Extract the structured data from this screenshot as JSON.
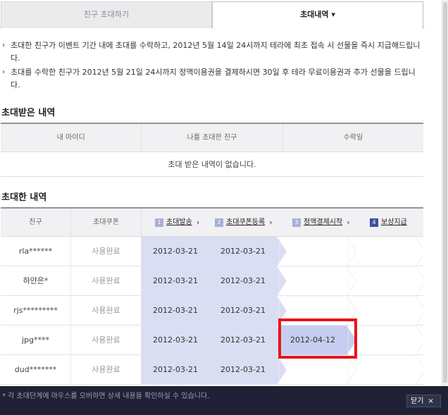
{
  "tabs": {
    "invite": "친구 초대하기",
    "history": "초대내역",
    "history_caret": "▼"
  },
  "notes": [
    {
      "bullet": "›",
      "text": "초대한 친구가 이벤트 기간 내에 초대를 수락하고, 2012년 5월 14일 24시까지 테라에 최초 접속 시 선물을 즉시 지급해드립니다."
    },
    {
      "bullet": "›",
      "text": "초대를 수락한 친구가 2012년 5월 21일 24시까지 정액이용권을 결제하시면 30일 후 테라 무료이용권과 추가 선물을 드립니다."
    }
  ],
  "received": {
    "title": "초대받은 내역",
    "headers": [
      "내 아이디",
      "나를 초대한 친구",
      "수락일"
    ],
    "empty": "초대 받은 내역이 없습니다."
  },
  "sent": {
    "title": "초대한 내역",
    "col_friend": "친구",
    "col_coupon": "초대쿠폰",
    "steps": [
      {
        "num": "1",
        "label": "초대발송",
        "arrow": "›"
      },
      {
        "num": "2",
        "label": "초대쿠폰등록",
        "arrow": "›"
      },
      {
        "num": "3",
        "label": "정액결제시작",
        "arrow": "›"
      },
      {
        "num": "4",
        "label": "보상지급",
        "arrow": ""
      }
    ],
    "rows": [
      {
        "friend": "rla******",
        "coupon": "사용완료",
        "s1": "2012-03-21",
        "s2": "2012-03-21",
        "s3": "",
        "s4": ""
      },
      {
        "friend": "하얀은*",
        "coupon": "사용완료",
        "s1": "2012-03-21",
        "s2": "2012-03-21",
        "s3": "",
        "s4": ""
      },
      {
        "friend": "rjs*********",
        "coupon": "사용완료",
        "s1": "2012-03-21",
        "s2": "2012-03-21",
        "s3": "",
        "s4": ""
      },
      {
        "friend": "jpg****",
        "coupon": "사용완료",
        "s1": "2012-03-21",
        "s2": "2012-03-21",
        "s3": "2012-04-12",
        "s4": ""
      },
      {
        "friend": "dud*******",
        "coupon": "사용완료",
        "s1": "2012-03-21",
        "s2": "2012-03-21",
        "s3": "",
        "s4": ""
      }
    ]
  },
  "footer": {
    "note": "* 각 초대단계에 마우스를 오버하면 상세 내용을 확인하실 수 있습니다.",
    "close": "닫기",
    "close_x": "×"
  },
  "colors": {
    "stage_fill": "#d9def3",
    "stage_fill_active": "#c7cdef",
    "highlight": "#e8141b",
    "footer_bg": "#1f2234"
  }
}
